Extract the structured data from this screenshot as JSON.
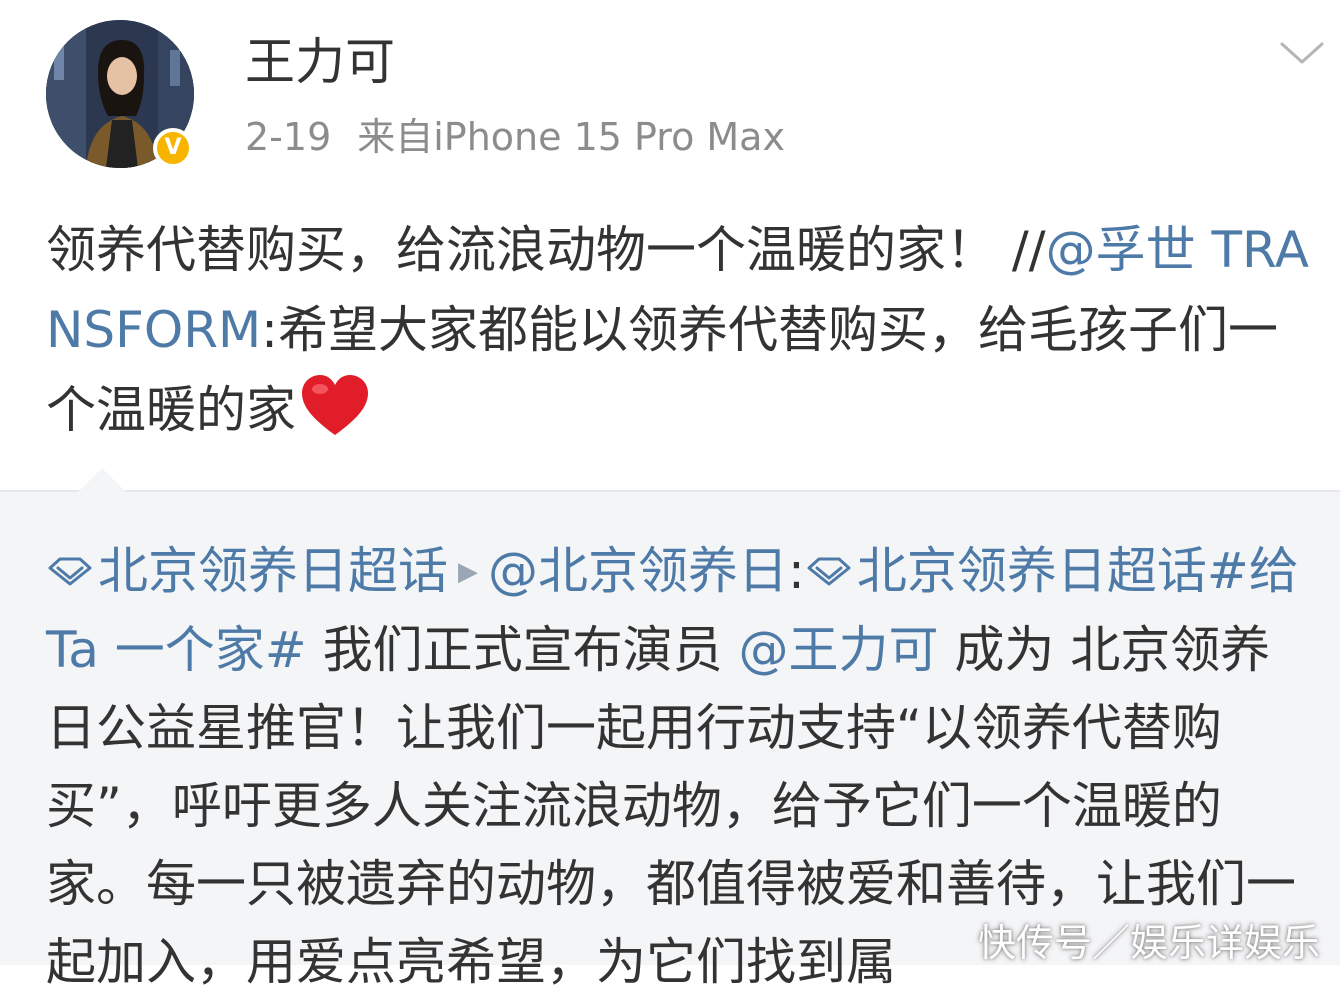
{
  "header": {
    "username": "王力可",
    "date": "2-19",
    "source": "来自iPhone 15 Pro Max",
    "verified_badge": "V",
    "avatar_icon": "user-avatar"
  },
  "post": {
    "text_main": "领养代替购买，给流浪动物一个温暖的家！ //",
    "mention": "@孚世 TRANSFORM",
    "colon": ":",
    "text_quote": "希望大家都能以领养代替购买，给毛孩子们一个温暖的家",
    "emoji": "red-heart"
  },
  "repost": {
    "topic1": "北京领养日超话",
    "mention1": "@北京领养日",
    "colon": ":",
    "topic2": "北京领养日超话",
    "hashtag": "#给 Ta 一个家#",
    "text1": " 我们正式宣布演员 ",
    "mention2": "@王力可",
    "text2": " 成为 北京领养日公益星推官！让我们一起用行动支持“以领养代替购买”，呼吁更多人关注流浪动物，给予它们一个温暖的家。每一只被遗弃的动物，都值得被爱和善待，让我们一起加入，用爱点亮希望，为它们找到属"
  },
  "watermark": "快传号／娱乐详娱乐",
  "colors": {
    "link": "#4e7aa8",
    "text": "#333333",
    "meta": "#8c8c8c",
    "repost_bg": "#f4f5f7",
    "badge": "#f7b500"
  }
}
